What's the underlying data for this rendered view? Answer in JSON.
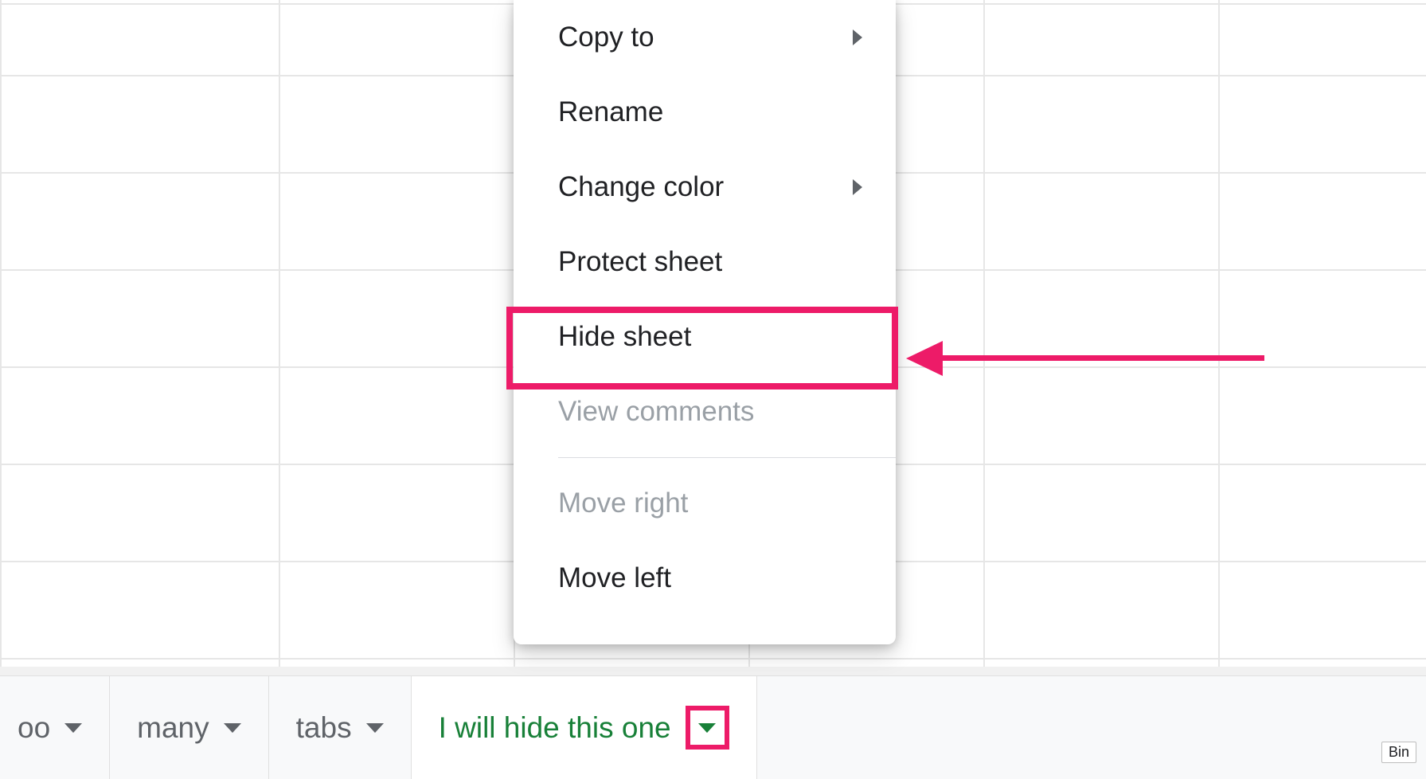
{
  "menu": {
    "items": [
      {
        "label": "Copy to",
        "submenu": true,
        "disabled": false
      },
      {
        "label": "Rename",
        "submenu": false,
        "disabled": false
      },
      {
        "label": "Change color",
        "submenu": true,
        "disabled": false
      },
      {
        "label": "Protect sheet",
        "submenu": false,
        "disabled": false
      },
      {
        "label": "Hide sheet",
        "submenu": false,
        "disabled": false,
        "highlighted": true
      },
      {
        "label": "View comments",
        "submenu": false,
        "disabled": true
      },
      {
        "label": "Move right",
        "submenu": false,
        "disabled": true
      },
      {
        "label": "Move left",
        "submenu": false,
        "disabled": false
      }
    ],
    "divider_after_index": 5
  },
  "tabs": [
    {
      "label": "oo",
      "active": false
    },
    {
      "label": "many",
      "active": false
    },
    {
      "label": "tabs",
      "active": false
    },
    {
      "label": "I will hide this one",
      "active": true,
      "caret_highlighted": true
    }
  ],
  "corner_label": "Bin",
  "annotation": {
    "highlight_color": "#ed1b68"
  }
}
